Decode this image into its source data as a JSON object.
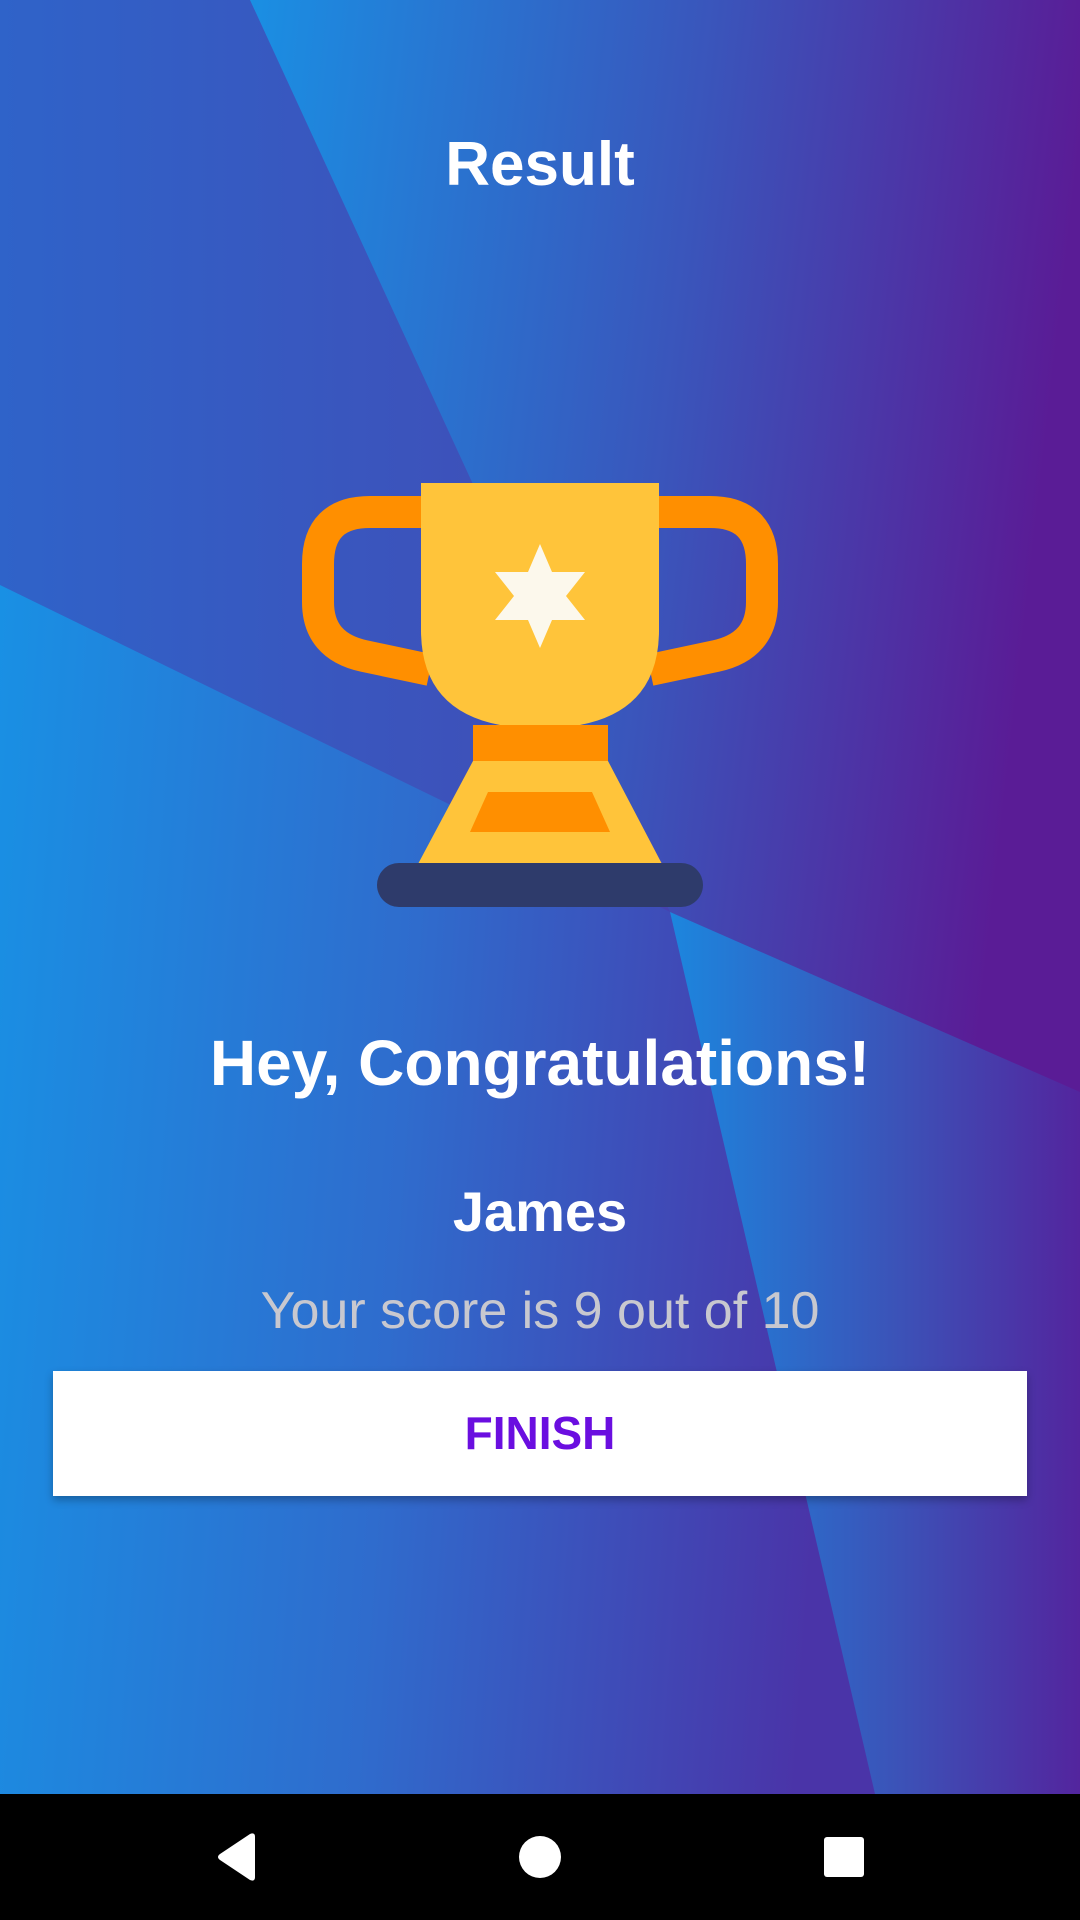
{
  "header": {
    "title": "Result"
  },
  "result": {
    "congrats": "Hey, Congratulations!",
    "name": "James",
    "score_text": "Your score is 9 out of 10"
  },
  "actions": {
    "finish_label": "FINISH"
  },
  "icons": {
    "trophy": "trophy-icon",
    "back": "back-icon",
    "home": "home-icon",
    "recent": "recent-apps-icon"
  },
  "colors": {
    "gradient_blue": "#1a8ee2",
    "gradient_indigo": "#3f51b5",
    "gradient_purple": "#5a1a94",
    "trophy_gold": "#ffc43a",
    "trophy_orange": "#ff8f00",
    "trophy_base": "#2e3b6b",
    "star": "#fcf8ec",
    "finish_text": "#6a0ee0"
  }
}
